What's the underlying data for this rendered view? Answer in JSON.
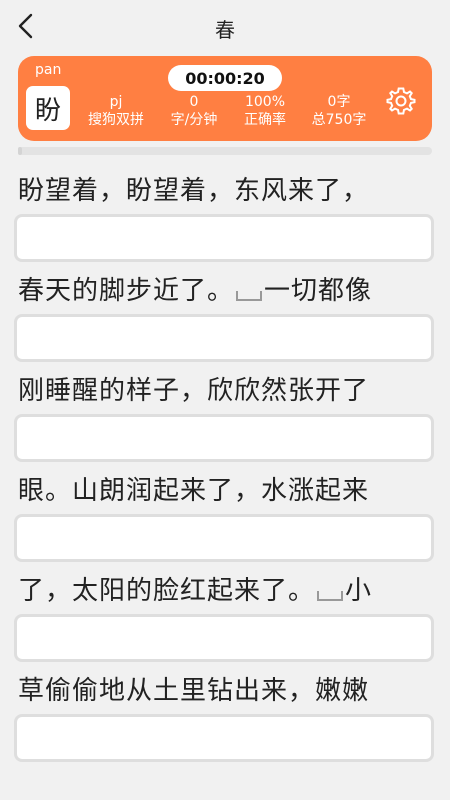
{
  "header": {
    "title": "春"
  },
  "status": {
    "pinyin": "pan",
    "current_char": "盼",
    "timer": "00:00:20",
    "scheme_code": "pj",
    "scheme_name": "搜狗双拼",
    "speed_value": "0",
    "speed_unit": "字/分钟",
    "accuracy_value": "100%",
    "accuracy_label": "正确率",
    "typed_value": "0字",
    "total_label": "总750字",
    "progress_fraction": 0.01
  },
  "lines": [
    {
      "text_a": "盼望着，盼望着，东风来了，",
      "text_b": "",
      "input": ""
    },
    {
      "text_a": "春天的脚步近了。",
      "text_b": "一切都像",
      "input": ""
    },
    {
      "text_a": "刚睡醒的样子，欣欣然张开了",
      "text_b": "",
      "input": ""
    },
    {
      "text_a": "眼。山朗润起来了，水涨起来",
      "text_b": "",
      "input": ""
    },
    {
      "text_a": "了，太阳的脸红起来了。",
      "text_b": "小",
      "input": ""
    },
    {
      "text_a": "草偷偷地从土里钻出来，嫩嫩",
      "text_b": "",
      "input": ""
    }
  ],
  "colors": {
    "accent": "#ff7f42",
    "page_bg": "#f1f1f1"
  }
}
